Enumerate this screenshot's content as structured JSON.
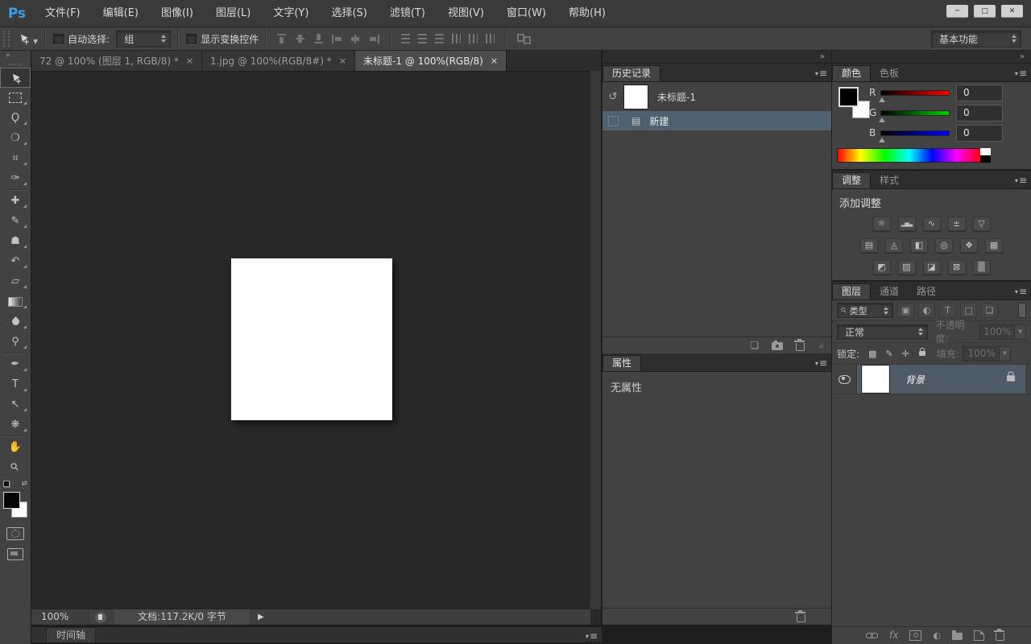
{
  "colors": {
    "selection": "#50606e",
    "layer_selection": "#4e5a66",
    "panel": "#424242",
    "canvas_bg": "#282828",
    "logo_accent": "#3aa0e8"
  },
  "menubar": {
    "logo": "Ps",
    "items": [
      "文件(F)",
      "编辑(E)",
      "图像(I)",
      "图层(L)",
      "文字(Y)",
      "选择(S)",
      "滤镜(T)",
      "视图(V)",
      "窗口(W)",
      "帮助(H)"
    ]
  },
  "window_controls": {
    "minimize": "─",
    "maximize": "□",
    "close": "✕"
  },
  "options_bar": {
    "auto_select_label": "自动选择:",
    "auto_select_value": "组",
    "show_transform_label": "显示变换控件",
    "workspace": "基本功能"
  },
  "document_tabs": [
    {
      "title": "72 @ 100% (图层 1, RGB/8) *",
      "close": "×"
    },
    {
      "title": "1.jpg @ 100%(RGB/8#) *",
      "close": "×"
    },
    {
      "title": "未标题-1 @ 100%(RGB/8)",
      "close": "×"
    }
  ],
  "status_bar": {
    "zoom": "100%",
    "doc_info": "文档:117.2K/0 字节",
    "arrow": "▶"
  },
  "timeline_panel": {
    "tab": "时间轴"
  },
  "history_panel": {
    "tab": "历史记录",
    "snapshot_name": "未标题-1",
    "state_name": "新建"
  },
  "properties_panel": {
    "tab": "属性",
    "empty_text": "无属性"
  },
  "color_panel": {
    "tab_color": "颜色",
    "tab_swatches": "色板",
    "channels": [
      {
        "label": "R",
        "value": "0"
      },
      {
        "label": "G",
        "value": "0"
      },
      {
        "label": "B",
        "value": "0"
      }
    ]
  },
  "adjustments_panel": {
    "tab_adjust": "调整",
    "tab_styles": "样式",
    "title": "添加调整"
  },
  "layers_panel": {
    "tab_layers": "图层",
    "tab_channels": "通道",
    "tab_paths": "路径",
    "filter_value": "类型",
    "blend_mode": "正常",
    "opacity_label": "不透明度:",
    "opacity_value": "100%",
    "lock_label": "锁定:",
    "fill_label": "填充:",
    "fill_value": "100%",
    "layer_name": "背景"
  },
  "icons": {
    "collapse-double": "»",
    "menu-arrow": "▾",
    "menu-lines": "≡",
    "tool-lasso": "Ϙ",
    "tool-quick-selection": "❍",
    "tool-crop": "⌗",
    "tool-eyedropper": "✑",
    "tool-spot-healing": "✚",
    "tool-brush": "✎",
    "tool-clone-stamp": "☗",
    "tool-history-brush": "↶",
    "tool-eraser": "▱",
    "tool-dodge": "⚲",
    "tool-pen": "✒",
    "tool-type": "T",
    "tool-path-selection": "↖",
    "tool-custom-shape": "❋",
    "tool-hand": "✋",
    "tool-zoom": "⚲",
    "history-source": "↺",
    "doc-item": "▤",
    "new-doc-from-state": "❏",
    "resize-grip": "◢",
    "adj-brightness": "☼",
    "adj-levels": "▂▅▃",
    "adj-curves": "∿",
    "adj-exposure": "±",
    "adj-vibrance": "▽",
    "adj-hue": "▤",
    "adj-colorbalance": "◬",
    "adj-bw": "◧",
    "adj-photofilter": "◎",
    "adj-channelmixer": "❖",
    "adj-colorlookup": "▦",
    "adj-invert": "◩",
    "adj-posterize": "▨",
    "adj-threshold": "◪",
    "adj-selectivecolor": "⊠",
    "adj-gradientmap": "▒",
    "filter-image": "▣",
    "filter-adjust": "◐",
    "filter-type": "T",
    "filter-shape": "□",
    "filter-smart": "❏",
    "search": "⚲",
    "lock-transparent": "▩",
    "lock-pixels": "✎",
    "lock-position": "✛",
    "swap-colors": "⇄"
  }
}
